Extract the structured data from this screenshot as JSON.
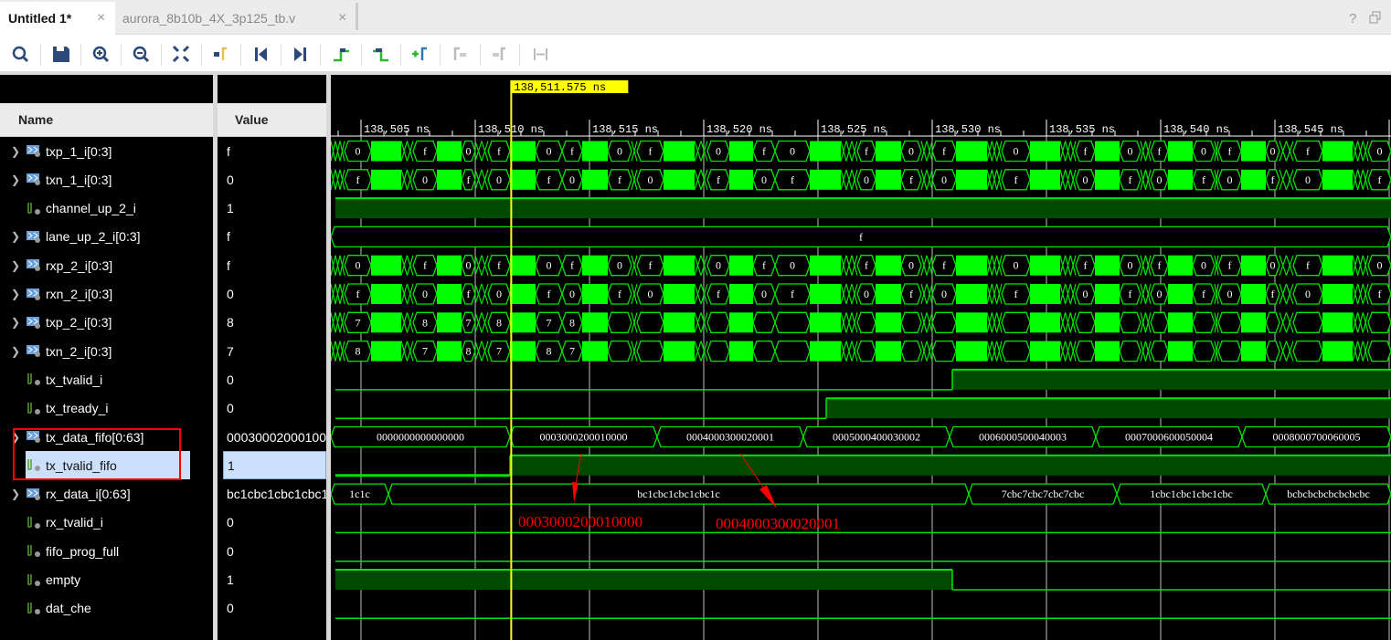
{
  "tabs": [
    {
      "label": "Untitled 1*",
      "active": true
    },
    {
      "label": "aurora_8b10b_4X_3p125_tb.v",
      "active": false
    }
  ],
  "window_buttons": {
    "help": "?",
    "restore": "restore-icon"
  },
  "toolbar": [
    {
      "icon": "search-icon",
      "enabled": true
    },
    {
      "icon": "save-icon",
      "enabled": true
    },
    {
      "icon": "zoom-in-icon",
      "enabled": true
    },
    {
      "icon": "zoom-out-icon",
      "enabled": true
    },
    {
      "icon": "zoom-fit-icon",
      "enabled": true
    },
    {
      "icon": "go-to-cursor-icon",
      "enabled": true
    },
    {
      "icon": "go-to-time-zero-icon",
      "enabled": true
    },
    {
      "icon": "go-to-last-time-icon",
      "enabled": true
    },
    {
      "icon": "previous-transition-icon",
      "enabled": true
    },
    {
      "icon": "next-transition-icon",
      "enabled": true
    },
    {
      "icon": "add-marker-icon",
      "enabled": true
    },
    {
      "icon": "previous-marker-icon",
      "enabled": false
    },
    {
      "icon": "next-marker-icon",
      "enabled": false
    },
    {
      "icon": "swap-cursors-icon",
      "enabled": false
    }
  ],
  "columns": {
    "name": "Name",
    "value": "Value"
  },
  "colors": {
    "wave": "#00e400",
    "solid": "#00ff00",
    "high_fill": "#004a00",
    "cursor": "#ffff00",
    "annotation": "#ff0000",
    "selection": "#cde0fb"
  },
  "time_window_ns": [
    138503.68,
    138550.08
  ],
  "cursor": {
    "time_ns": 138511.575,
    "label": "138,511.575 ns"
  },
  "ruler": {
    "major_ticks_ns": [
      138505,
      138510,
      138515,
      138520,
      138525,
      138530,
      138535,
      138540,
      138545,
      138550
    ],
    "labels": [
      "138,505 ns",
      "138,510 ns",
      "138,515 ns",
      "138,520 ns",
      "138,525 ns",
      "138,530 ns",
      "138,535 ns",
      "138,540 ns",
      "138,545 ns"
    ],
    "minor_step_ns": 1
  },
  "fast_edges_ns": [
    138503.68,
    138504.28,
    138505.44,
    138506.76,
    138507.28,
    138508.32,
    138509.4,
    138510.0,
    138510.56,
    138511.52,
    138512.64,
    138513.8,
    138514.68,
    138515.8,
    138516.84,
    138517.08,
    138518.24,
    138519.6,
    138520.16,
    138521.12,
    138522.16,
    138523.12,
    138524.64,
    138526.0,
    138526.72,
    138527.52,
    138528.64,
    138529.52,
    138530.0,
    138531.04,
    138532.4,
    138533.04,
    138534.28,
    138535.6,
    138536.28,
    138537.12,
    138538.2,
    138539.12,
    138539.56,
    138540.32,
    138541.4,
    138542.36,
    138542.52,
    138543.52,
    138544.6,
    138545.2,
    138545.8,
    138547.08,
    138548.4,
    138549.08,
    138550.08
  ],
  "signals": [
    {
      "name": "txp_1_i[0:3]",
      "value": "f",
      "kind": "bus",
      "expandable": true,
      "wave": {
        "edges": "fast",
        "values": [
          "x",
          "0",
          "#",
          "x",
          "f",
          "#",
          "0",
          "x",
          "f",
          "#",
          "0",
          "f",
          "#",
          "0",
          "x",
          "f",
          "#",
          "x",
          "0",
          "#",
          "f",
          "0",
          "#",
          "x",
          "f",
          "#",
          "0",
          "x",
          "f",
          "#",
          "x",
          "0",
          "#",
          "x",
          "f",
          "#",
          "0",
          "x",
          "f",
          "#",
          "0",
          "x",
          "f",
          "#",
          "0",
          "x",
          "f",
          "#",
          "x",
          "0"
        ]
      }
    },
    {
      "name": "txn_1_i[0:3]",
      "value": "0",
      "kind": "bus",
      "expandable": true,
      "wave": {
        "edges": "fast",
        "values": [
          "x",
          "f",
          "#",
          "x",
          "0",
          "#",
          "f",
          "x",
          "0",
          "#",
          "f",
          "0",
          "#",
          "f",
          "x",
          "0",
          "#",
          "x",
          "f",
          "#",
          "0",
          "f",
          "#",
          "x",
          "0",
          "#",
          "f",
          "x",
          "0",
          "#",
          "x",
          "f",
          "#",
          "x",
          "0",
          "#",
          "f",
          "x",
          "0",
          "#",
          "f",
          "x",
          "0",
          "#",
          "f",
          "x",
          "0",
          "#",
          "x",
          "f"
        ]
      }
    },
    {
      "name": "channel_up_2_i",
      "value": "1",
      "kind": "bit",
      "expandable": false,
      "wave": {
        "edges": [
          138503.88,
          138550.08
        ],
        "values": [
          1
        ]
      }
    },
    {
      "name": "lane_up_2_i[0:3]",
      "value": "f",
      "kind": "bus",
      "expandable": true,
      "wave": {
        "edges": [
          138503.68,
          138550.08
        ],
        "values": [
          "f"
        ]
      }
    },
    {
      "name": "rxp_2_i[0:3]",
      "value": "f",
      "kind": "bus",
      "expandable": true,
      "wave": {
        "edges": "fast",
        "values": [
          "x",
          "0",
          "#",
          "x",
          "f",
          "#",
          "0",
          "x",
          "f",
          "#",
          "0",
          "f",
          "#",
          "0",
          "x",
          "f",
          "#",
          "x",
          "0",
          "#",
          "f",
          "0",
          "#",
          "x",
          "f",
          "#",
          "0",
          "x",
          "f",
          "#",
          "x",
          "0",
          "#",
          "x",
          "f",
          "#",
          "0",
          "x",
          "f",
          "#",
          "0",
          "x",
          "f",
          "#",
          "0",
          "x",
          "f",
          "#",
          "x",
          "0"
        ]
      }
    },
    {
      "name": "rxn_2_i[0:3]",
      "value": "0",
      "kind": "bus",
      "expandable": true,
      "wave": {
        "edges": "fast",
        "values": [
          "x",
          "f",
          "#",
          "x",
          "0",
          "#",
          "f",
          "x",
          "0",
          "#",
          "f",
          "0",
          "#",
          "f",
          "x",
          "0",
          "#",
          "x",
          "f",
          "#",
          "0",
          "f",
          "#",
          "x",
          "0",
          "#",
          "f",
          "x",
          "0",
          "#",
          "x",
          "f",
          "#",
          "x",
          "0",
          "#",
          "f",
          "x",
          "0",
          "#",
          "f",
          "x",
          "0",
          "#",
          "f",
          "x",
          "0",
          "#",
          "x",
          "f"
        ]
      }
    },
    {
      "name": "txp_2_i[0:3]",
      "value": "8",
      "kind": "bus",
      "expandable": true,
      "wave": {
        "edges": "fast",
        "values": [
          "x",
          "7",
          "#",
          "x",
          "8",
          "#",
          "7",
          "x",
          "8",
          "#",
          "7",
          "8",
          "#",
          "",
          "x",
          "",
          "#",
          "x",
          "",
          "#",
          "",
          "",
          "#",
          "x",
          "",
          "#",
          "",
          "x",
          "",
          "#",
          "x",
          "",
          "#",
          "x",
          "",
          "#",
          "",
          "x",
          "",
          "#",
          "",
          "x",
          "",
          "#",
          "",
          "x",
          "",
          "#",
          "x",
          ""
        ]
      }
    },
    {
      "name": "txn_2_i[0:3]",
      "value": "7",
      "kind": "bus",
      "expandable": true,
      "wave": {
        "edges": "fast",
        "values": [
          "x",
          "8",
          "#",
          "x",
          "7",
          "#",
          "8",
          "x",
          "7",
          "#",
          "8",
          "7",
          "#",
          "",
          "x",
          "",
          "#",
          "x",
          "",
          "#",
          "",
          "",
          "#",
          "x",
          "",
          "#",
          "",
          "x",
          "",
          "#",
          "x",
          "",
          "#",
          "x",
          "",
          "#",
          "",
          "x",
          "",
          "#",
          "",
          "x",
          "",
          "#",
          "",
          "x",
          "",
          "#",
          "x",
          ""
        ]
      }
    },
    {
      "name": "tx_tvalid_i",
      "value": "0",
      "kind": "bit",
      "expandable": false,
      "wave": {
        "edges": [
          138503.88,
          138530.88,
          138550.08
        ],
        "values": [
          0,
          1
        ]
      }
    },
    {
      "name": "tx_tready_i",
      "value": "0",
      "kind": "bit",
      "expandable": false,
      "wave": {
        "edges": [
          138503.88,
          138525.36,
          138550.08
        ],
        "values": [
          0,
          1
        ]
      }
    },
    {
      "name": "tx_data_fifo[0:63]",
      "value": "0003000200010000",
      "kind": "bus",
      "expandable": true,
      "wave": {
        "edges": [
          138503.68,
          138511.52,
          138517.96,
          138524.36,
          138530.76,
          138537.16,
          138543.56,
          138550.08
        ],
        "values": [
          "0000000000000000",
          "0003000200010000",
          "0004000300020001",
          "0005000400030002",
          "0006000500040003",
          "0007000600050004",
          "0008000700060005"
        ]
      }
    },
    {
      "name": "tx_tvalid_fifo",
      "value": "1",
      "kind": "bit",
      "expandable": false,
      "selected": true,
      "wave": {
        "edges": [
          138503.88,
          138511.52,
          138550.08
        ],
        "values": [
          0,
          1
        ]
      }
    },
    {
      "name": "rx_data_i[0:63]",
      "value": "bc1cbc1cbc1cbc1c",
      "kind": "bus",
      "expandable": true,
      "wave": {
        "edges": [
          138503.68,
          138506.2,
          138531.6,
          138538.08,
          138544.6,
          138550.08
        ],
        "values": [
          "1c1c",
          "bc1cbc1cbc1cbc1c",
          "7cbc7cbc7cbc7cbc",
          "1cbc1cbc1cbc1cbc",
          "bcbcbcbcbcbcbcbc"
        ]
      }
    },
    {
      "name": "rx_tvalid_i",
      "value": "0",
      "kind": "bit",
      "expandable": false,
      "wave": {
        "edges": [
          138503.88,
          138550.08
        ],
        "values": [
          0
        ]
      }
    },
    {
      "name": "fifo_prog_full",
      "value": "0",
      "kind": "bit",
      "expandable": false,
      "wave": {
        "edges": [
          138503.88,
          138550.08
        ],
        "values": [
          0
        ]
      }
    },
    {
      "name": "empty",
      "value": "1",
      "kind": "bit",
      "expandable": false,
      "wave": {
        "edges": [
          138503.88,
          138530.88,
          138550.08
        ],
        "values": [
          1,
          0
        ]
      }
    },
    {
      "name": "dat_che",
      "value": "0",
      "kind": "bit",
      "expandable": false,
      "wave": {
        "edges": [
          138503.88,
          138550.08
        ],
        "values": [
          0
        ]
      }
    }
  ],
  "annotations": [
    "0003000200010000",
    "0004000300020001"
  ]
}
